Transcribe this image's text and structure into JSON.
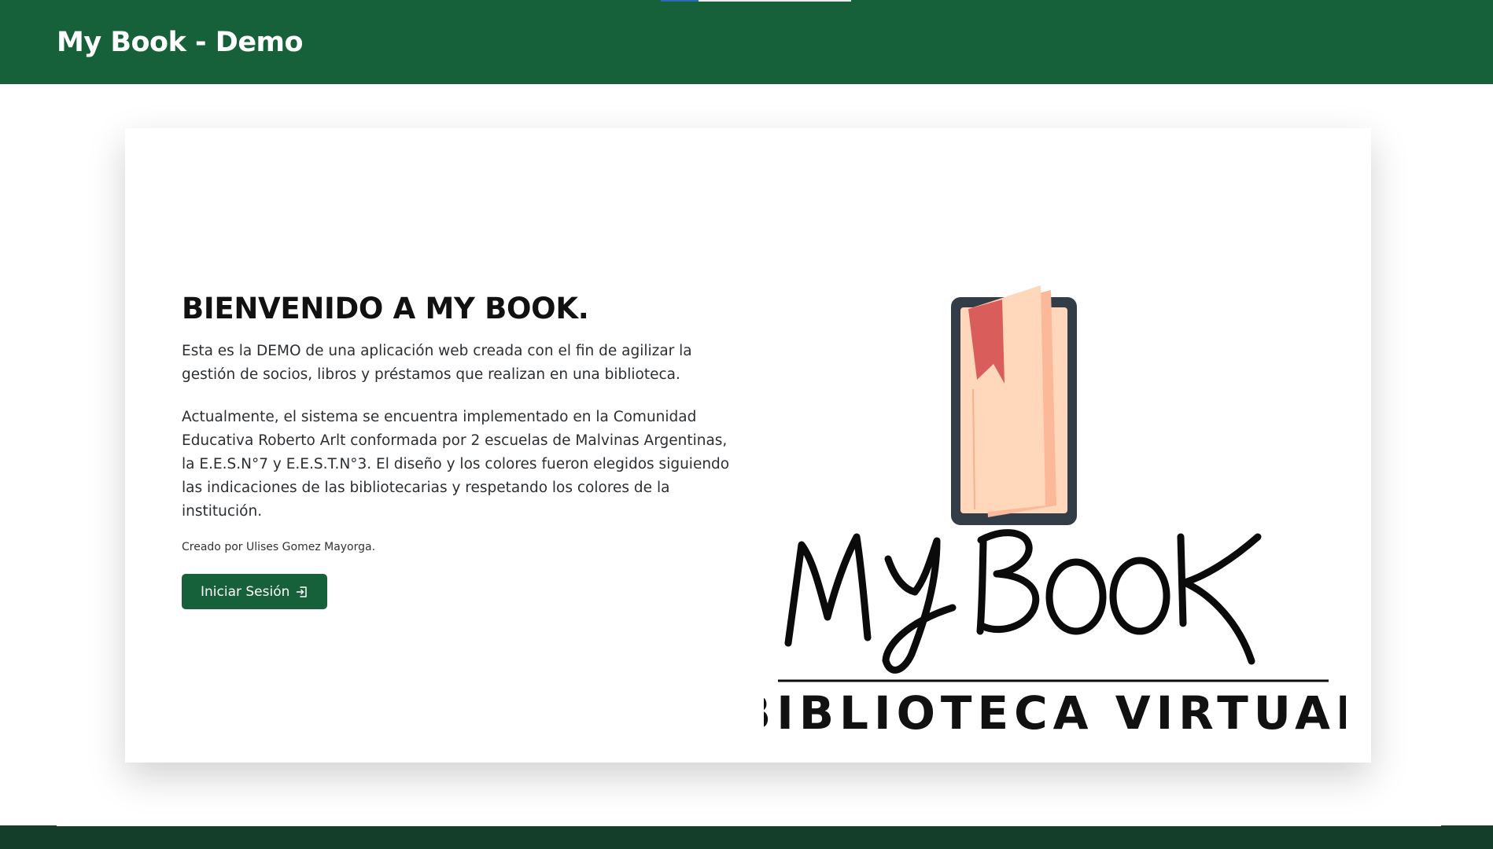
{
  "header": {
    "brand": "My Book - Demo"
  },
  "main": {
    "title": "BIENVENIDO A MY BOOK.",
    "paragraph1": "Esta es la DEMO de una aplicación web creada con el fin de agilizar la gestión de socios, libros y préstamos que realizan en una biblioteca.",
    "paragraph2": "Actualmente, el sistema se encuentra implementado en la Comunidad Educativa Roberto Arlt conformada por 2 escuelas de Malvinas Argentinas, la E.E.S.N°7 y E.E.S.T.N°3. El diseño y los colores fueron elegidos siguiendo las indicaciones de las bibliotecarias y respetando los colores de la institución.",
    "credit": "Creado por Ulises Gomez Mayorga.",
    "login_button": "Iniciar Sesión",
    "login_icon": "login-arrow-icon"
  },
  "logo": {
    "brand_text": "MY BOOK",
    "subtitle": "BIBLIOTECA VIRTUAL",
    "icon": "phone-book-icon"
  },
  "colors": {
    "primary": "#17613a",
    "footer": "#143e2a",
    "text": "#212529"
  }
}
